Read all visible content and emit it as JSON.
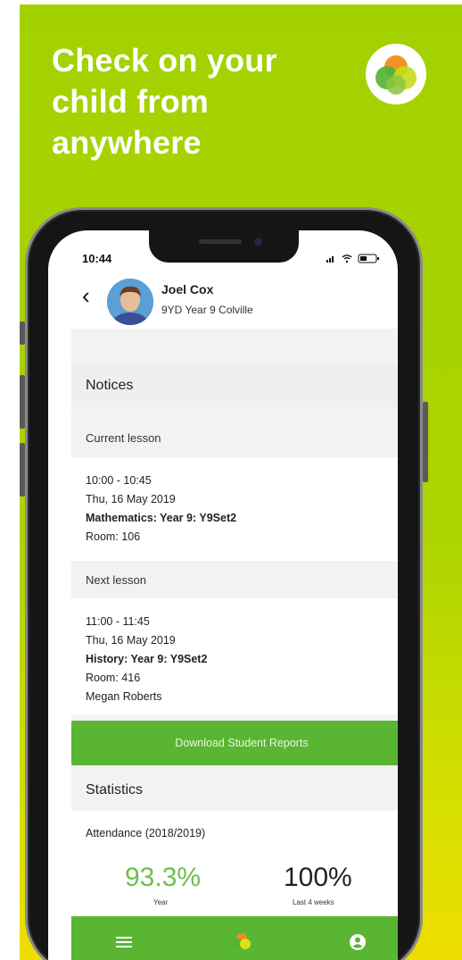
{
  "banner": {
    "headline_lines": [
      "Check on your",
      "child from",
      "anywhere"
    ],
    "bg_color": "#a3d100"
  },
  "status_bar": {
    "time": "10:44",
    "right_icons": "signal wifi battery"
  },
  "student": {
    "name": "Joel Cox",
    "info": "9YD  Year 9  Colville"
  },
  "notices": {
    "title": "Notices",
    "current_lesson": {
      "label": "Current lesson",
      "time": "10:00 - 10:45",
      "date": "Thu, 16 May 2019",
      "subject": "Mathematics: Year 9: Y9Set2",
      "room": "Room: 106"
    },
    "next_lesson": {
      "label": "Next lesson",
      "time": "11:00 - 11:45",
      "date": "Thu, 16 May 2019",
      "subject": "History: Year 9: Y9Set2",
      "room": "Room: 416",
      "teacher": "Megan Roberts"
    }
  },
  "download_button": "Download Student Reports",
  "statistics": {
    "title": "Statistics",
    "attendance_label": "Attendance (2018/2019)",
    "year_value": "93.3%",
    "year_caption": "Year",
    "recent_value": "100%",
    "recent_caption": "Last 4 weeks"
  },
  "tabbar": {
    "icons": [
      "menu-icon",
      "app-logo-icon",
      "account-icon"
    ]
  },
  "colors": {
    "accent_green": "#5ab532",
    "percent_green": "#6cc04a"
  }
}
